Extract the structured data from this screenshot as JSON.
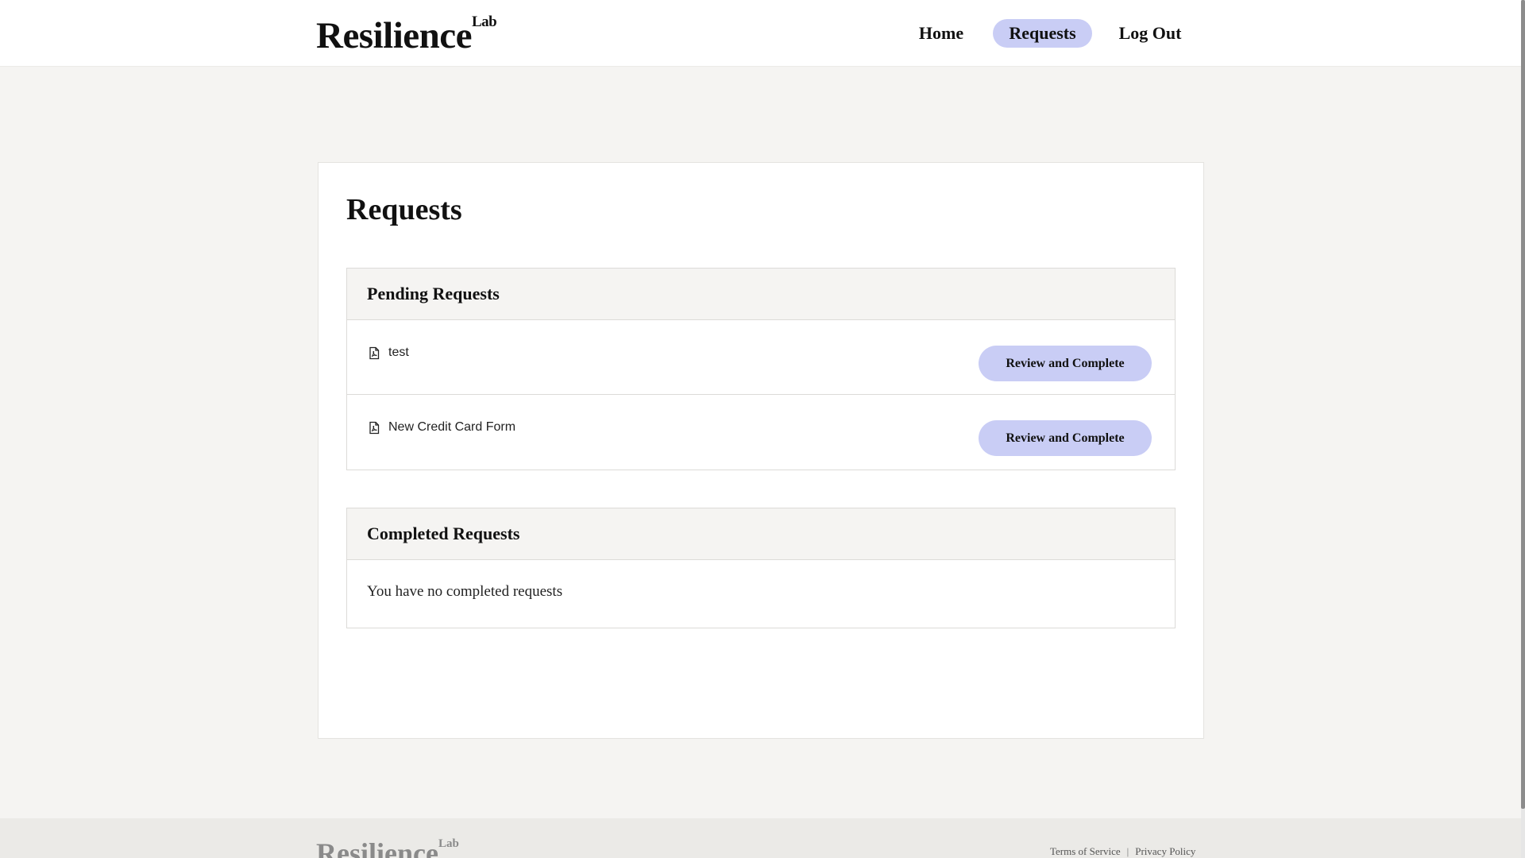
{
  "header": {
    "logo_text": "Resilience",
    "logo_sup": "Lab",
    "nav": {
      "home": "Home",
      "requests": "Requests",
      "logout": "Log Out"
    },
    "active_nav": "requests",
    "accent_color": "#c9cdf5"
  },
  "main": {
    "title": "Requests",
    "pending": {
      "heading": "Pending Requests",
      "items": [
        {
          "name": "test",
          "icon": "pdf-file-icon",
          "action_label": "Review and Complete"
        },
        {
          "name": "New Credit Card Form",
          "icon": "pdf-file-icon",
          "action_label": "Review and Complete"
        }
      ]
    },
    "completed": {
      "heading": "Completed Requests",
      "empty_message": "You have no completed requests"
    }
  },
  "footer": {
    "logo_text": "Resilience",
    "logo_sup": "Lab",
    "links": {
      "terms": "Terms of Service",
      "separator": "|",
      "privacy": "Privacy Policy"
    }
  }
}
